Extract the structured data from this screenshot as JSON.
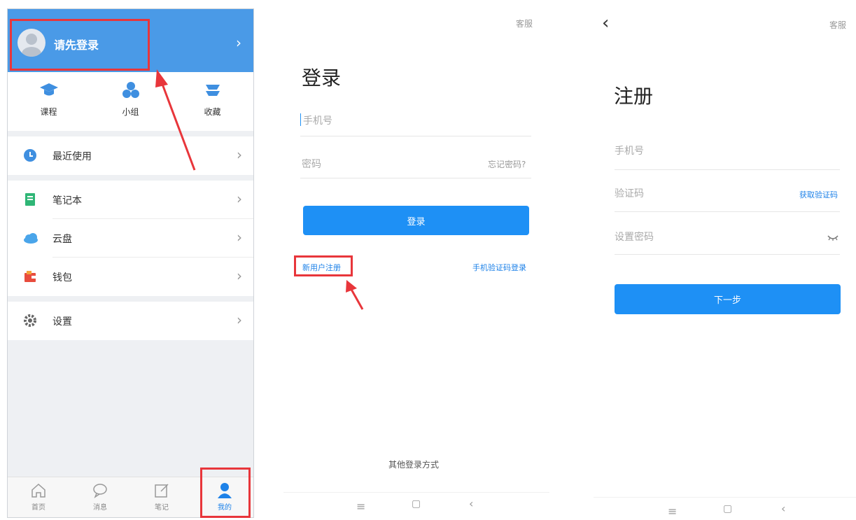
{
  "profile": {
    "login_prompt": "请先登录",
    "quick": [
      {
        "icon": "graduation-cap-icon",
        "label": "课程"
      },
      {
        "icon": "group-icon",
        "label": "小组"
      },
      {
        "icon": "bookmark-stack-icon",
        "label": "收藏"
      }
    ],
    "menu": [
      {
        "icon": "clock-icon",
        "label": "最近使用"
      },
      {
        "icon": "notebook-icon",
        "label": "笔记本"
      },
      {
        "icon": "cloud-icon",
        "label": "云盘"
      },
      {
        "icon": "wallet-icon",
        "label": "钱包"
      },
      {
        "icon": "gear-icon",
        "label": "设置"
      }
    ],
    "tabs": [
      {
        "icon": "home-icon",
        "label": "首页"
      },
      {
        "icon": "message-icon",
        "label": "消息"
      },
      {
        "icon": "note-edit-icon",
        "label": "笔记"
      },
      {
        "icon": "person-icon",
        "label": "我的",
        "active": true
      }
    ],
    "colors": {
      "header": "#4a9ae7",
      "highlight": "#e8363b"
    }
  },
  "login": {
    "support": "客服",
    "title": "登录",
    "phone_placeholder": "手机号",
    "password_placeholder": "密码",
    "forgot_password": "忘记密码?",
    "login_button": "登录",
    "register_link": "新用户注册",
    "sms_login_link": "手机验证码登录",
    "other_methods": "其他登录方式"
  },
  "register": {
    "back": "‹",
    "support": "客服",
    "title": "注册",
    "phone_placeholder": "手机号",
    "code_placeholder": "验证码",
    "get_code": "获取验证码",
    "password_placeholder": "设置密码",
    "next_button": "下一步"
  },
  "system_nav": {
    "menu": "≡",
    "home": "▢",
    "back": "‹"
  },
  "accent": "#1e90f5"
}
